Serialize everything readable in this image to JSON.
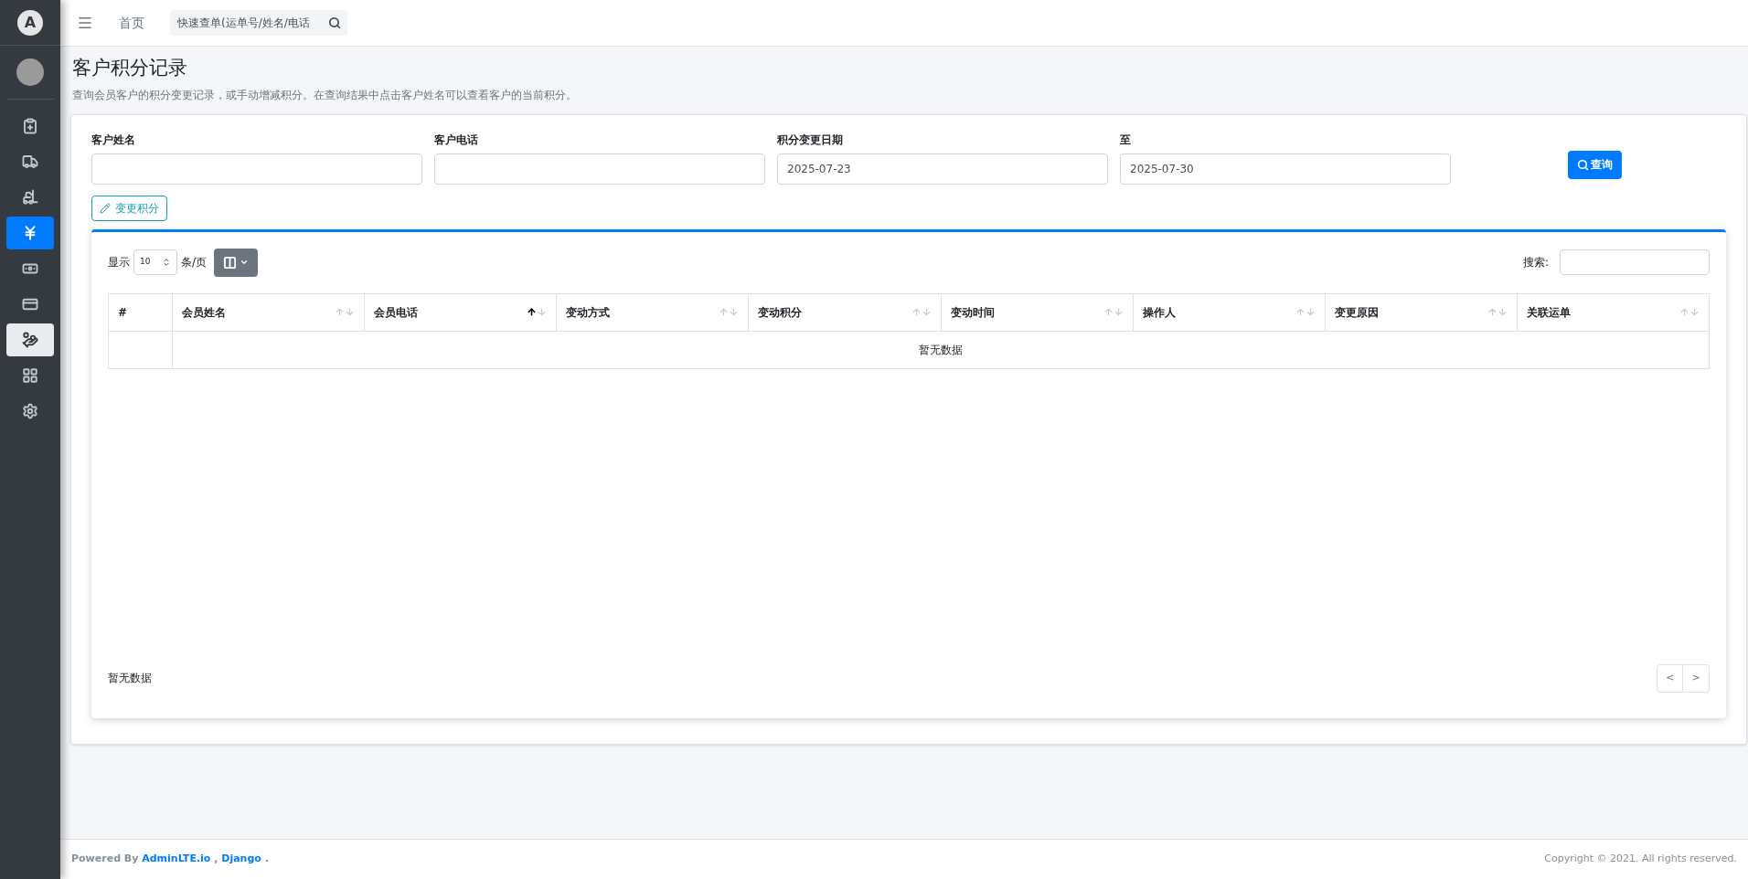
{
  "sidebar": {
    "logo": "A",
    "items": [
      {
        "selected": false,
        "hovered": false
      },
      {
        "selected": false,
        "hovered": false
      },
      {
        "selected": false,
        "hovered": false
      },
      {
        "selected": true,
        "hovered": false
      },
      {
        "selected": false,
        "hovered": false
      },
      {
        "selected": false,
        "hovered": false
      },
      {
        "selected": false,
        "hovered": true
      },
      {
        "selected": false,
        "hovered": false
      },
      {
        "selected": false,
        "hovered": false
      }
    ]
  },
  "topbar": {
    "home": "首页",
    "search": {
      "placeholder": "快速查单(运单号/姓名/电话"
    }
  },
  "page": {
    "title": "客户积分记录",
    "description": "查询会员客户的积分变更记录，或手动增减积分。在查询结果中点击客户姓名可以查看客户的当前积分。"
  },
  "filters": [
    {
      "label": "客户姓名"
    },
    {
      "label": "客户电话"
    },
    {
      "label": "积分变更日期",
      "value": "2025-07-23"
    },
    {
      "label": "至",
      "value": "2025-07-30"
    }
  ],
  "query_button": "查询",
  "change_button": "变更积分",
  "table": {
    "show_label": "显示",
    "page_size": "10",
    "per_page_label": "条/页",
    "search_label": "搜索:",
    "columns": [
      {
        "label": "#",
        "sortable": false
      },
      {
        "label": "会员姓名",
        "sortable": true,
        "sorted_ascending": false
      },
      {
        "label": "会员电话",
        "sortable": true,
        "sorted_ascending": true
      },
      {
        "label": "变动方式",
        "sortable": true,
        "sorted_ascending": false
      },
      {
        "label": "变动积分",
        "sortable": true,
        "sorted_ascending": false
      },
      {
        "label": "变动时间",
        "sortable": true,
        "sorted_ascending": false
      },
      {
        "label": "操作人",
        "sortable": true,
        "sorted_ascending": false
      },
      {
        "label": "变更原因",
        "sortable": true,
        "sorted_ascending": false
      },
      {
        "label": "关联运单",
        "sortable": true,
        "sorted_ascending": false
      }
    ],
    "empty": "暂无数据",
    "info": "暂无数据",
    "pagination": {
      "prev": "<",
      "next": ">"
    }
  },
  "footer": {
    "prefix": "Powered By",
    "links": [
      "AdminLTE.io",
      "Django"
    ],
    "separator": ",",
    "suffix": ".",
    "copyright": "Copyright © 2021. All rights reserved."
  }
}
